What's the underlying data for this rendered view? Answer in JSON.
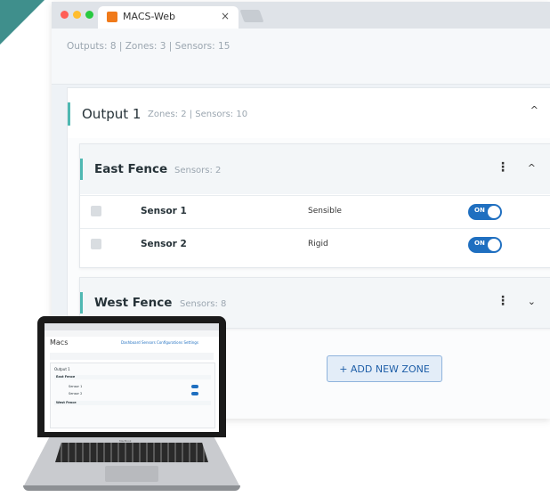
{
  "browser": {
    "tab_title": "MACS-Web",
    "tab_close": "×"
  },
  "summary": {
    "text": "Outputs: 8  |  Zones: 3  |  Sensors: 15"
  },
  "output": {
    "title": "Output 1",
    "meta": "Zones: 2  |  Sensors: 10",
    "chevron": "^"
  },
  "zones": [
    {
      "title": "East Fence",
      "meta": "Sensors: 2",
      "kebab": "⋮",
      "chevron": "^",
      "sensors": [
        {
          "name": "Sensor 1",
          "type": "Sensible",
          "toggle": "ON"
        },
        {
          "name": "Sensor 2",
          "type": "Rigid",
          "toggle": "ON"
        }
      ]
    },
    {
      "title": "West Fence",
      "meta": "Sensors: 8",
      "kebab": "⋮",
      "chevron": "⌄"
    }
  ],
  "add_zone_label": "+ ADD NEW ZONE",
  "laptop": {
    "logo": "Macs",
    "nav": "Dashboard  Sensors  Configurations  Settings",
    "brand": "MacBook",
    "output_title": "Output 1",
    "zone1": "East Fence",
    "sensor1": "Sensor 1",
    "sensor2": "Sensor 2",
    "zone2": "West Fence"
  },
  "colors": {
    "accent_teal": "#4fb8b2",
    "toggle_blue": "#1f6fc0",
    "tab_icon_orange": "#f07a1a"
  }
}
